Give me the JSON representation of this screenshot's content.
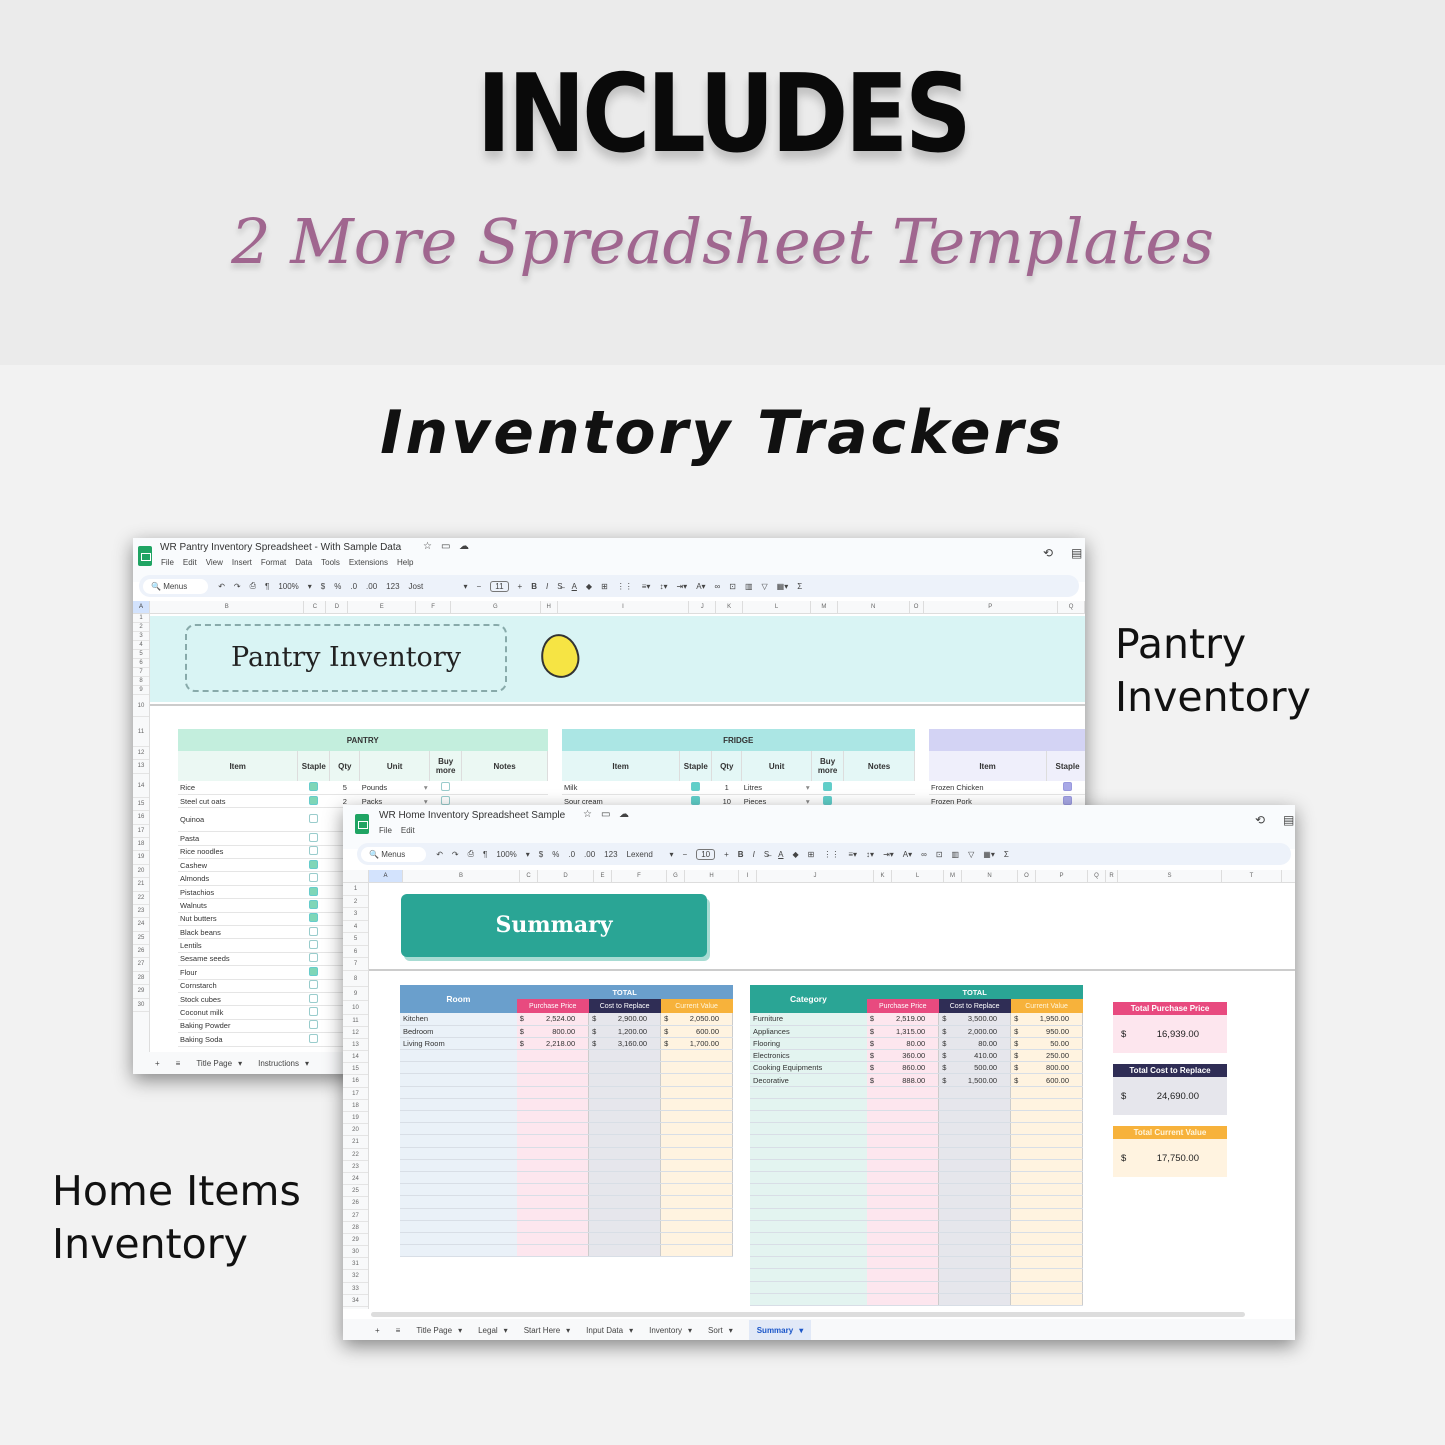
{
  "hero": {
    "title": "INCLUDES",
    "subtitle": "2 More Spreadsheet Templates",
    "section_title": "Inventory Trackers",
    "label_pantry": [
      "Pantry",
      "Inventory"
    ],
    "label_home": [
      "Home Items",
      "Inventory"
    ]
  },
  "colors": {
    "sheets_green": "#1fa463",
    "subtitle": "#a0668f",
    "summary_teal": "#2aa595",
    "pink": "#e84a7f",
    "navy": "#2f2d55",
    "orange": "#f7b23b",
    "room_blue": "#6a9fcc"
  },
  "pantry_window": {
    "doc_title": "WR Pantry Inventory Spreadsheet - With Sample Data",
    "menu": [
      "File",
      "Edit",
      "View",
      "Insert",
      "Format",
      "Data",
      "Tools",
      "Extensions",
      "Help"
    ],
    "toolbar": {
      "search": "Menus",
      "zoom": "100%",
      "currency": "$",
      "percent": "%",
      "dec_dec": ".0",
      "dec_inc": ".00",
      "format": "123",
      "font": "Jost",
      "font_size": "11",
      "bold": "B",
      "italic": "I"
    },
    "columns": [
      "A",
      "B",
      "C",
      "D",
      "E",
      "F",
      "G",
      "H",
      "I",
      "J",
      "K",
      "L",
      "M",
      "N",
      "O",
      "P",
      "Q"
    ],
    "rows": [
      "1",
      "2",
      "3",
      "4",
      "5",
      "6",
      "7",
      "8",
      "9",
      "10",
      "11",
      "12",
      "13",
      "14",
      "15",
      "16",
      "17",
      "18",
      "19",
      "20",
      "21",
      "22",
      "23",
      "24",
      "25",
      "26",
      "27",
      "28",
      "29",
      "30"
    ],
    "banner_title": "Pantry Inventory",
    "pantry": {
      "header": "PANTRY",
      "cols": [
        "Item",
        "Staple",
        "Qty",
        "Unit",
        "Buy more",
        "Notes"
      ],
      "rows": [
        {
          "item": "Rice",
          "staple": true,
          "qty": "5",
          "unit": "Pounds",
          "buy": false
        },
        {
          "item": "Steel cut oats",
          "staple": true,
          "qty": "2",
          "unit": "Packs",
          "buy": false
        },
        {
          "item": "Quinoa",
          "staple": false
        },
        {
          "item": "Pasta",
          "staple": false
        },
        {
          "item": "Rice noodles",
          "staple": false
        },
        {
          "item": "Cashew",
          "staple": true
        },
        {
          "item": "Almonds",
          "staple": false
        },
        {
          "item": "Pistachios",
          "staple": true
        },
        {
          "item": "Walnuts",
          "staple": true
        },
        {
          "item": "Nut butters",
          "staple": true
        },
        {
          "item": "Black beans",
          "staple": false
        },
        {
          "item": "Lentils",
          "staple": false
        },
        {
          "item": "Sesame seeds",
          "staple": false
        },
        {
          "item": "Flour",
          "staple": true
        },
        {
          "item": "Cornstarch",
          "staple": false
        },
        {
          "item": "Stock cubes",
          "staple": false
        },
        {
          "item": "Coconut milk",
          "staple": false
        },
        {
          "item": "Baking Powder",
          "staple": false
        },
        {
          "item": "Baking Soda",
          "staple": false
        }
      ]
    },
    "fridge": {
      "header": "FRIDGE",
      "cols": [
        "Item",
        "Staple",
        "Qty",
        "Unit",
        "Buy more",
        "Notes"
      ],
      "rows": [
        {
          "item": "Milk",
          "staple": true,
          "qty": "1",
          "unit": "Litres",
          "buy": true
        },
        {
          "item": "Sour cream",
          "staple": true,
          "qty": "10",
          "unit": "Pieces",
          "buy": true
        }
      ]
    },
    "freezer": {
      "cols": [
        "Item",
        "Staple"
      ],
      "rows": [
        {
          "item": "Frozen Chicken",
          "staple": true
        },
        {
          "item": "Frozen Pork",
          "staple": true
        }
      ]
    },
    "tabs": [
      "Title Page",
      "Instructions"
    ]
  },
  "home_window": {
    "doc_title": "WR Home Inventory Spreadsheet Sample",
    "menu": [
      "File",
      "Edit"
    ],
    "toolbar": {
      "search": "Menus",
      "zoom": "100%",
      "currency": "$",
      "percent": "%",
      "dec_dec": ".0",
      "dec_inc": ".00",
      "format": "123",
      "font": "Lexend",
      "font_size": "10",
      "bold": "B",
      "italic": "I"
    },
    "columns": [
      "A",
      "B",
      "C",
      "D",
      "E",
      "F",
      "G",
      "H",
      "I",
      "J",
      "K",
      "L",
      "M",
      "N",
      "O",
      "P",
      "Q",
      "R",
      "S",
      "T"
    ],
    "rows": [
      "1",
      "2",
      "3",
      "4",
      "5",
      "6",
      "7",
      "8",
      "9",
      "10",
      "11",
      "12",
      "13",
      "14",
      "15",
      "16",
      "17",
      "18",
      "19",
      "20",
      "21",
      "22",
      "23",
      "24",
      "25",
      "26",
      "27",
      "28",
      "29",
      "30",
      "31",
      "32",
      "33",
      "34"
    ],
    "summary_title": "Summary",
    "room_table": {
      "key_header": "Room",
      "total_header": "TOTAL",
      "cols": [
        "Purchase Price",
        "Cost to Replace",
        "Current Value"
      ],
      "rows": [
        {
          "name": "Kitchen",
          "purchase": "2,524.00",
          "replace": "2,900.00",
          "current": "2,050.00"
        },
        {
          "name": "Bedroom",
          "purchase": "800.00",
          "replace": "1,200.00",
          "current": "600.00"
        },
        {
          "name": "Living Room",
          "purchase": "2,218.00",
          "replace": "3,160.00",
          "current": "1,700.00"
        }
      ]
    },
    "category_table": {
      "key_header": "Category",
      "total_header": "TOTAL",
      "cols": [
        "Purchase Price",
        "Cost to Replace",
        "Current Value"
      ],
      "rows": [
        {
          "name": "Furniture",
          "purchase": "2,519.00",
          "replace": "3,500.00",
          "current": "1,950.00"
        },
        {
          "name": "Appliances",
          "purchase": "1,315.00",
          "replace": "2,000.00",
          "current": "950.00"
        },
        {
          "name": "Flooring",
          "purchase": "80.00",
          "replace": "80.00",
          "current": "50.00"
        },
        {
          "name": "Electronics",
          "purchase": "360.00",
          "replace": "410.00",
          "current": "250.00"
        },
        {
          "name": "Cooking Equipments",
          "purchase": "860.00",
          "replace": "500.00",
          "current": "800.00"
        },
        {
          "name": "Decorative",
          "purchase": "888.00",
          "replace": "1,500.00",
          "current": "600.00"
        }
      ]
    },
    "currency_symbol": "$",
    "totals": [
      {
        "label": "Total Purchase Price",
        "value": "16,939.00"
      },
      {
        "label": "Total Cost to Replace",
        "value": "24,690.00"
      },
      {
        "label": "Total Current Value",
        "value": "17,750.00"
      }
    ],
    "tabs": [
      "Title Page",
      "Legal",
      "Start Here",
      "Input Data",
      "Inventory",
      "Sort",
      "Summary"
    ],
    "active_tab": "Summary"
  }
}
